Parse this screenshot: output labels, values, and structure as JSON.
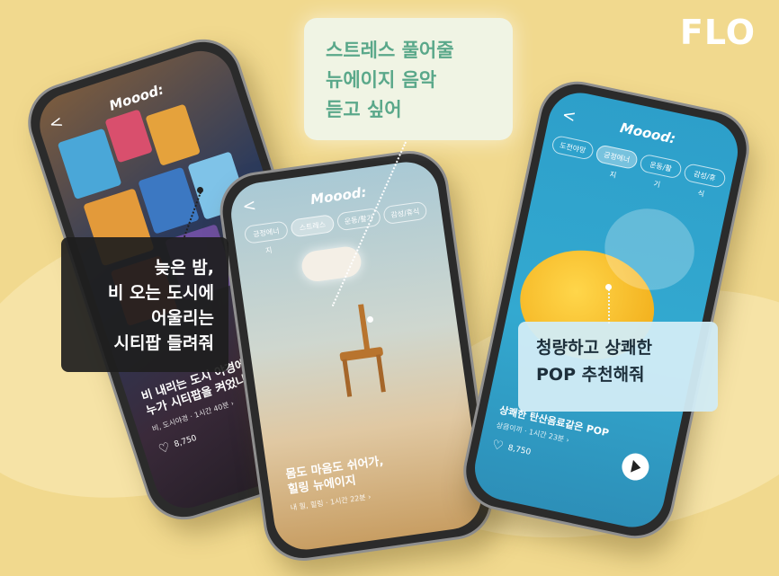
{
  "brand": {
    "logo": "FLO"
  },
  "callouts": {
    "middle": "스트레스 풀어줄\n뉴에이지 음악\n듣고 싶어",
    "left": "늦은 밤,\n비 오는 도시에\n어울리는\n시티팝 들려줘",
    "right": "청량하고 상쾌한\nPOP 추천해줘"
  },
  "phones": {
    "left": {
      "header": "Moood:",
      "back": "<",
      "title": "비 내리는 도시 야경에\n누가 시티팝을 켜었나",
      "meta": "비, 도시야경 · 1시간 40분 ›",
      "likes": "8,750"
    },
    "center": {
      "header": "Moood:",
      "back": "<",
      "chips": [
        "긍정에너지",
        "스트레스",
        "운동/활기",
        "감성/휴식"
      ],
      "title": "몸도 마음도 쉬어가,\n힐링 뉴에이지",
      "meta": "내 힐, 힐링 · 1시간 22분 ›"
    },
    "right": {
      "header": "Moood:",
      "back": "<",
      "chips": [
        "도전야망",
        "긍정에너지",
        "운동/활기",
        "감성/휴식"
      ],
      "title": "상쾌한 탄산음료같은 POP",
      "meta": "상큼이끼 · 1시간 23분 ›",
      "likes": "8,750"
    }
  },
  "colors": {
    "background": "#f1d98e",
    "accent_green": "#5aa88a",
    "dark_bubble": "#1e1e1e",
    "blue_bubble": "#d2ecf6"
  }
}
